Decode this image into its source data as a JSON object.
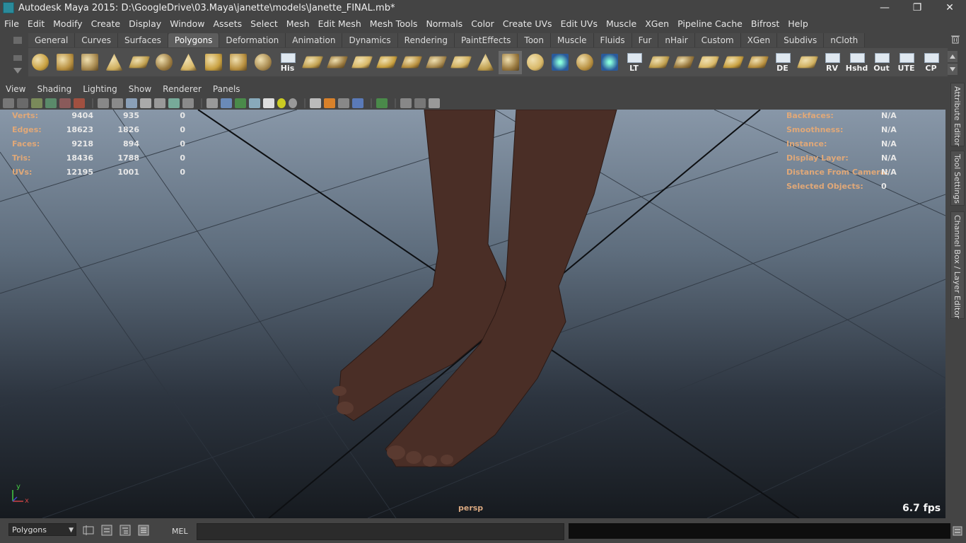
{
  "window": {
    "title": "Autodesk Maya 2015: D:\\GoogleDrive\\03.Maya\\janette\\models\\Janette_FINAL.mb*",
    "controls": [
      "—",
      "❐",
      "✕"
    ]
  },
  "menubar": [
    "File",
    "Edit",
    "Modify",
    "Create",
    "Display",
    "Window",
    "Assets",
    "Select",
    "Mesh",
    "Edit Mesh",
    "Mesh Tools",
    "Normals",
    "Color",
    "Create UVs",
    "Edit UVs",
    "Muscle",
    "XGen",
    "Pipeline Cache",
    "Bifrost",
    "Help"
  ],
  "shelf": {
    "tabs": [
      "General",
      "Curves",
      "Surfaces",
      "Polygons",
      "Deformation",
      "Animation",
      "Dynamics",
      "Rendering",
      "PaintEffects",
      "Toon",
      "Muscle",
      "Fluids",
      "Fur",
      "nHair",
      "Custom",
      "XGen",
      "Subdivs",
      "nCloth"
    ],
    "active_tab": "Polygons",
    "icons": [
      {
        "name": "poly-sphere-icon",
        "label": ""
      },
      {
        "name": "poly-cube-icon",
        "label": ""
      },
      {
        "name": "poly-cylinder-icon",
        "label": ""
      },
      {
        "name": "poly-cone-icon",
        "label": ""
      },
      {
        "name": "poly-plane-icon",
        "label": ""
      },
      {
        "name": "poly-torus-icon",
        "label": ""
      },
      {
        "name": "poly-pyramid-icon",
        "label": ""
      },
      {
        "name": "poly-pipe-icon",
        "label": ""
      },
      {
        "name": "poly-helix-icon",
        "label": ""
      },
      {
        "name": "poly-soccerball-icon",
        "label": ""
      },
      {
        "name": "history-icon",
        "label": "His"
      },
      {
        "name": "extrude-icon",
        "label": ""
      },
      {
        "name": "bridge-icon",
        "label": ""
      },
      {
        "name": "append-polygon-icon",
        "label": ""
      },
      {
        "name": "split-polygon-icon",
        "label": ""
      },
      {
        "name": "insert-edge-loop-icon",
        "label": ""
      },
      {
        "name": "merge-vertices-icon",
        "label": ""
      },
      {
        "name": "bevel-icon",
        "label": ""
      },
      {
        "name": "sculpt-icon",
        "label": ""
      },
      {
        "name": "paint-tool-icon",
        "label": ""
      },
      {
        "name": "smooth-mesh-icon",
        "label": ""
      },
      {
        "name": "soft-select-icon",
        "label": ""
      },
      {
        "name": "snap-rotate-icon",
        "label": ""
      },
      {
        "name": "transfer-attributes-icon",
        "label": ""
      },
      {
        "name": "lattice-icon",
        "label": "LT"
      },
      {
        "name": "uv-planar-icon",
        "label": ""
      },
      {
        "name": "uv-cylindrical-icon",
        "label": ""
      },
      {
        "name": "uv-spherical-icon",
        "label": ""
      },
      {
        "name": "uv-automatic-icon",
        "label": ""
      },
      {
        "name": "uv-layout-icon",
        "label": ""
      },
      {
        "name": "display-edges-icon",
        "label": "DE"
      },
      {
        "name": "uv-editor-icon",
        "label": ""
      },
      {
        "name": "rv-icon",
        "label": "RV"
      },
      {
        "name": "hshd-icon",
        "label": "Hshd"
      },
      {
        "name": "out-icon",
        "label": "Out"
      },
      {
        "name": "ute-icon",
        "label": "UTE"
      },
      {
        "name": "cp-icon",
        "label": "CP"
      }
    ]
  },
  "viewport": {
    "menu": [
      "View",
      "Shading",
      "Lighting",
      "Show",
      "Renderer",
      "Panels"
    ],
    "hud_left": [
      {
        "label": "Verts:",
        "v1": "9404",
        "v2": "935",
        "v3": "0"
      },
      {
        "label": "Edges:",
        "v1": "18623",
        "v2": "1826",
        "v3": "0"
      },
      {
        "label": "Faces:",
        "v1": "9218",
        "v2": "894",
        "v3": "0"
      },
      {
        "label": "Tris:",
        "v1": "18436",
        "v2": "1788",
        "v3": "0"
      },
      {
        "label": "UVs:",
        "v1": "12195",
        "v2": "1001",
        "v3": "0"
      }
    ],
    "hud_right": [
      {
        "label": "Backfaces:",
        "value": "N/A"
      },
      {
        "label": "Smoothness:",
        "value": "N/A"
      },
      {
        "label": "Instance:",
        "value": "N/A"
      },
      {
        "label": "Display Layer:",
        "value": "N/A"
      },
      {
        "label": "Distance From Camera:",
        "value": "N/A"
      },
      {
        "label": "Selected Objects:",
        "value": "0"
      }
    ],
    "camera": "persp",
    "fps": "6.7 fps",
    "axis": {
      "y": "y",
      "x": "x"
    }
  },
  "side_tabs": [
    "Attribute Editor",
    "Tool Settings",
    "Channel Box / Layer Editor"
  ],
  "status": {
    "mode": "Polygons",
    "mel_label": "MEL"
  }
}
